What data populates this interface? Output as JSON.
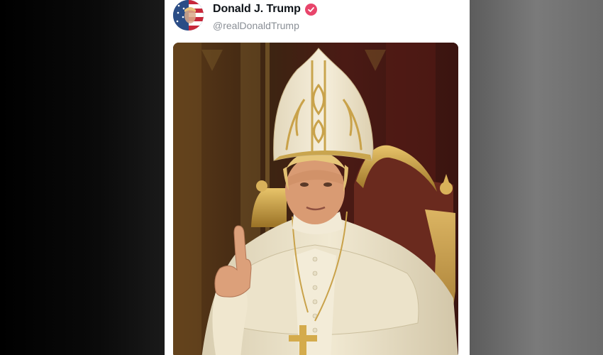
{
  "post": {
    "author": {
      "display_name": "Donald J. Trump",
      "handle": "@realDonaldTrump",
      "verified": true,
      "avatar_icon": "flag-portrait-avatar",
      "verified_color": "#e8456b"
    },
    "media": {
      "kind": "image",
      "subject": "figure in white papal vestments and gold-embroidered mitre seated on gilded throne, right index finger raised"
    }
  },
  "colors": {
    "card_bg": "#ffffff",
    "name_text": "#0f1419",
    "handle_text": "#8a8f96",
    "left_backdrop": "#000000",
    "right_backdrop": "#6e6e6e"
  }
}
